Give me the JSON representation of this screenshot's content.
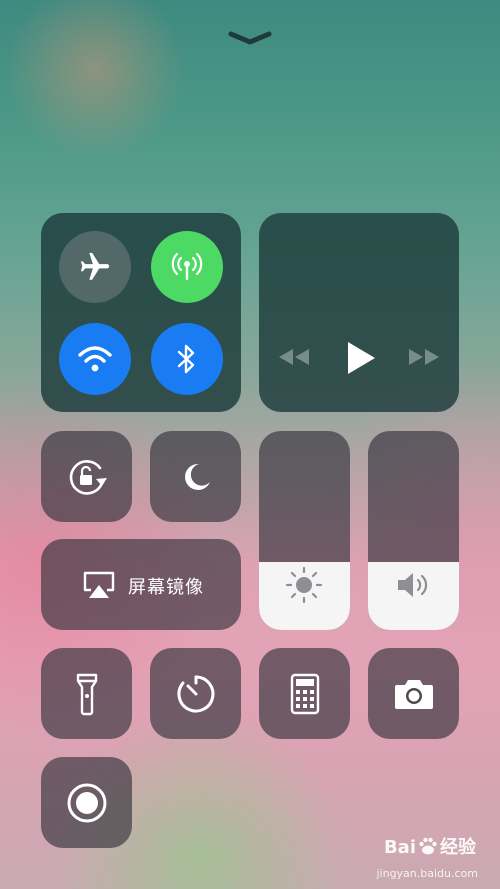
{
  "control_center": {
    "screen_mirroring_label": "屏幕镜像",
    "brightness_level": 0.34,
    "volume_level": 0.34,
    "toggles": {
      "airplane_mode": "off",
      "cellular_data": "on",
      "wifi": "on",
      "bluetooth": "on"
    }
  },
  "colors": {
    "cellular_green": "#4cd964",
    "active_blue": "#1a7cf2"
  },
  "icons": [
    "chevron-down-icon",
    "airplane-icon",
    "cellular-antenna-icon",
    "wifi-icon",
    "bluetooth-icon",
    "rewind-icon",
    "play-icon",
    "fast-forward-icon",
    "rotation-lock-icon",
    "moon-icon",
    "airplay-icon",
    "sun-icon",
    "speaker-icon",
    "flashlight-icon",
    "timer-icon",
    "calculator-icon",
    "camera-icon",
    "screen-record-icon",
    "baidu-paw-icon"
  ],
  "watermark": {
    "brand_prefix": "Bai",
    "brand_suffix": "经验",
    "url": "jingyan.baidu.com"
  }
}
